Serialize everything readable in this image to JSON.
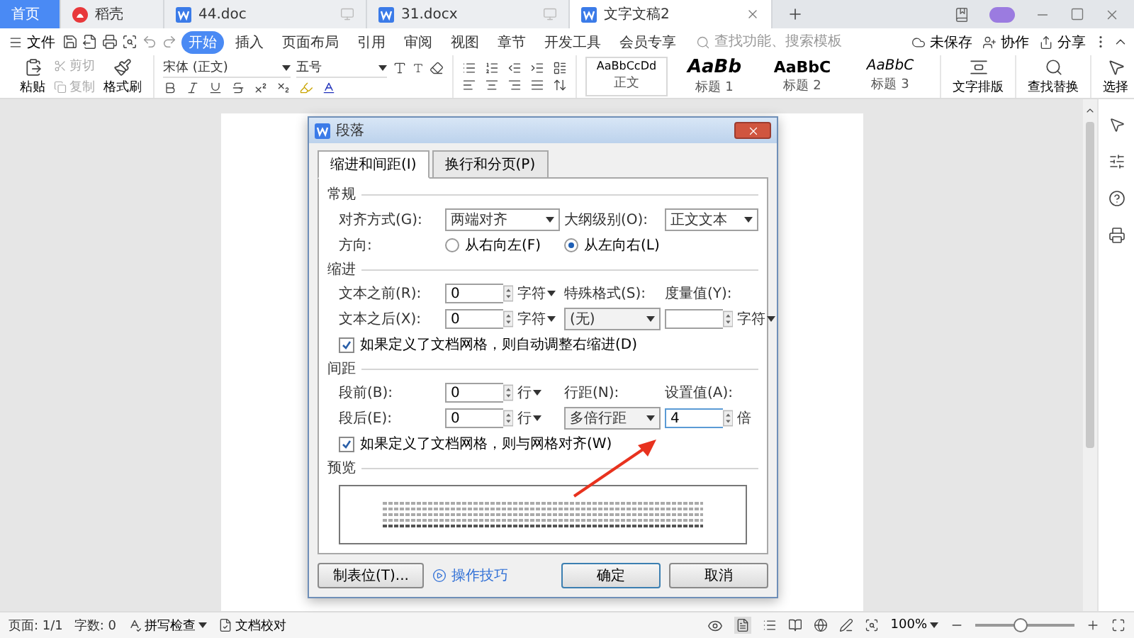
{
  "tabs": [
    {
      "label": "首页",
      "kind": "home",
      "selected": false
    },
    {
      "label": "稻壳",
      "kind": "docer",
      "selected": false
    },
    {
      "label": "44.doc",
      "kind": "doc",
      "selected": false
    },
    {
      "label": "31.docx",
      "kind": "doc",
      "selected": false
    },
    {
      "label": "文字文稿2",
      "kind": "doc",
      "selected": true
    }
  ],
  "menu": {
    "file": "文件",
    "items": [
      {
        "label": "开始",
        "selected": true
      },
      {
        "label": "插入",
        "selected": false
      },
      {
        "label": "页面布局",
        "selected": false
      },
      {
        "label": "引用",
        "selected": false
      },
      {
        "label": "审阅",
        "selected": false
      },
      {
        "label": "视图",
        "selected": false
      },
      {
        "label": "章节",
        "selected": false
      },
      {
        "label": "开发工具",
        "selected": false
      },
      {
        "label": "会员专享",
        "selected": false
      }
    ],
    "search": {
      "placeholder": "查找功能、搜索模板"
    },
    "actions": [
      {
        "label": "未保存",
        "kind": "cloud"
      },
      {
        "label": "协作",
        "kind": "user"
      },
      {
        "label": "分享",
        "kind": "share"
      }
    ]
  },
  "ribbon": {
    "paste": "粘贴",
    "clipboard": [
      {
        "label": "剪切",
        "kind": "cut",
        "disabled": true
      },
      {
        "label": "复制",
        "kind": "copy",
        "disabled": true
      }
    ],
    "format_painter": "格式刷",
    "font": {
      "name": "宋体 (正文)",
      "size": "五号"
    },
    "styles": [
      {
        "sample": "AaBbCcDd",
        "label": "正文",
        "kind": "body"
      },
      {
        "sample": "AaBb",
        "label": "标题 1",
        "kind": "h1"
      },
      {
        "sample": "AaBbC",
        "label": "标题 2",
        "kind": "h2"
      },
      {
        "sample": "AaBbC",
        "label": "标题 3",
        "kind": "h3"
      }
    ],
    "tools": [
      {
        "label": "文字排版",
        "kind": "layout"
      },
      {
        "label": "查找替换",
        "kind": "find"
      },
      {
        "label": "选择",
        "kind": "select"
      }
    ]
  },
  "dialog": {
    "title": "段落",
    "tabs": [
      {
        "label": "缩进和间距(I)",
        "selected": true
      },
      {
        "label": "换行和分页(P)",
        "selected": false
      }
    ],
    "general": {
      "title": "常规",
      "alignment_label": "对齐方式(G):",
      "alignment": "两端对齐",
      "outline_label": "大纲级别(O):",
      "outline": "正文文本",
      "direction_label": "方向:",
      "directions": [
        {
          "label": "从右向左(F)",
          "selected": false
        },
        {
          "label": "从左向右(L)",
          "selected": true
        }
      ]
    },
    "indent": {
      "title": "缩进",
      "before_label": "文本之前(R):",
      "before": "0",
      "before_unit": "字符",
      "after_label": "文本之后(X):",
      "after": "0",
      "after_unit": "字符",
      "special_label": "特殊格式(S):",
      "special": "(无)",
      "measure_label": "度量值(Y):",
      "measure_unit": "字符",
      "auto_adjust": {
        "label": "如果定义了文档网格，则自动调整右缩进(D)",
        "checked": true
      }
    },
    "spacing": {
      "title": "间距",
      "before_label": "段前(B):",
      "before": "0",
      "before_unit": "行",
      "after_label": "段后(E):",
      "after": "0",
      "after_unit": "行",
      "line_label": "行距(N):",
      "line": "多倍行距",
      "value_label": "设置值(A):",
      "value": "4",
      "value_unit": "倍",
      "snap_grid": {
        "label": "如果定义了文档网格，则与网格对齐(W)",
        "checked": true
      }
    },
    "preview_title": "预览",
    "tabs_button": "制表位(T)...",
    "tips_link": "操作技巧",
    "ok": "确定",
    "cancel": "取消"
  },
  "status": {
    "page": "页面: 1/1",
    "words": "字数: 0",
    "spell": "拼写检查",
    "proof": "文档校对",
    "zoom": "100%",
    "zoom_slider": {
      "level": 0.45
    }
  }
}
